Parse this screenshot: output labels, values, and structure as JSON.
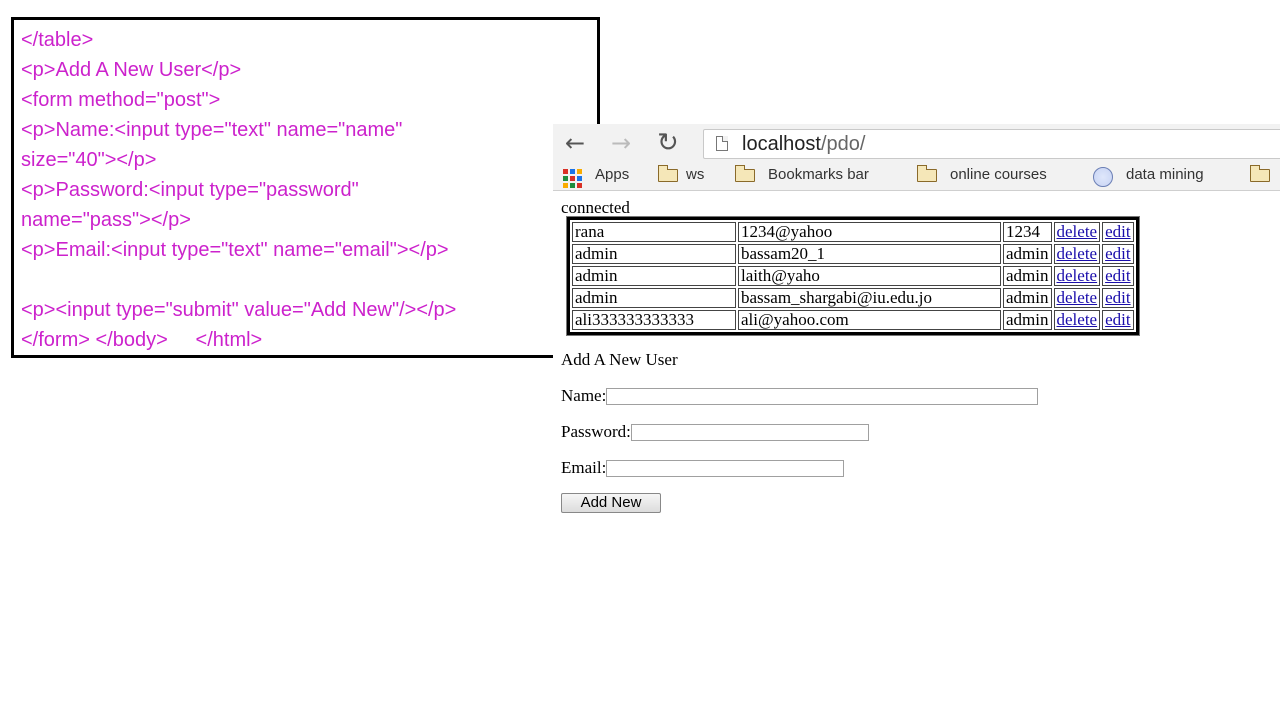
{
  "code": {
    "lines": [
      "</table>",
      "<p>Add A New User</p>",
      "<form method=\"post\">",
      "<p>Name:<input type=\"text\" name=\"name\"",
      "size=\"40\"></p>",
      "<p>Password:<input type=\"password\"",
      "name=\"pass\"></p>",
      "<p>Email:<input type=\"text\" name=\"email\"></p>",
      "",
      "<p><input type=\"submit\" value=\"Add New\"/></p>",
      "</form> </body>     </html>"
    ]
  },
  "browser": {
    "url_host": "localhost",
    "url_path": "/pdo/",
    "bookmarks": [
      {
        "icon": "apps-icon",
        "label": "Apps"
      },
      {
        "icon": "folder-icon",
        "label": "ws"
      },
      {
        "icon": "folder-icon",
        "label": "Bookmarks bar"
      },
      {
        "icon": "folder-icon",
        "label": "online courses"
      },
      {
        "icon": "globe-icon",
        "label": "data mining"
      }
    ]
  },
  "page": {
    "status": "connected",
    "users": [
      {
        "name": "rana",
        "email": "1234@yahoo",
        "pass": "1234",
        "delete": "delete",
        "edit": "edit"
      },
      {
        "name": "admin",
        "email": "bassam20_1",
        "pass": "admin",
        "delete": "delete",
        "edit": "edit"
      },
      {
        "name": "admin",
        "email": "laith@yaho",
        "pass": "admin",
        "delete": "delete",
        "edit": "edit"
      },
      {
        "name": "admin",
        "email": "bassam_shargabi@iu.edu.jo",
        "pass": "admin",
        "delete": "delete",
        "edit": "edit"
      },
      {
        "name": "ali333333333333",
        "email": "ali@yahoo.com",
        "pass": "admin",
        "delete": "delete",
        "edit": "edit"
      }
    ],
    "form_title": "Add A New User",
    "name_label": "Name:",
    "password_label": "Password:",
    "email_label": "Email:",
    "submit_label": "Add New"
  }
}
